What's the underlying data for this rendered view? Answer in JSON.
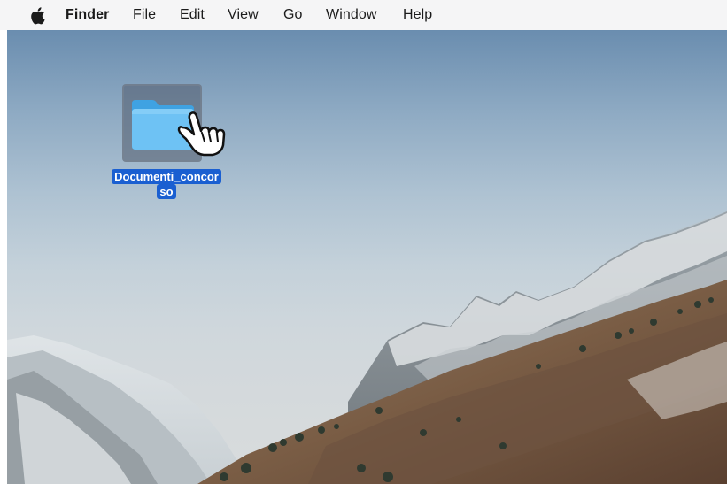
{
  "menubar": {
    "apple_icon": "apple-logo",
    "app_name": "Finder",
    "items": [
      "File",
      "Edit",
      "View",
      "Go",
      "Window",
      "Help"
    ]
  },
  "desktop": {
    "folder": {
      "name_line1": "Documenti_concor",
      "name_line2": "so",
      "icon": "folder-icon",
      "selected": true,
      "folder_color": "#5cb7ef"
    },
    "cursor": "pointing-hand-cursor"
  },
  "colors": {
    "selection_label": "#1a5fd1",
    "menubar": "#f5f5f6"
  }
}
